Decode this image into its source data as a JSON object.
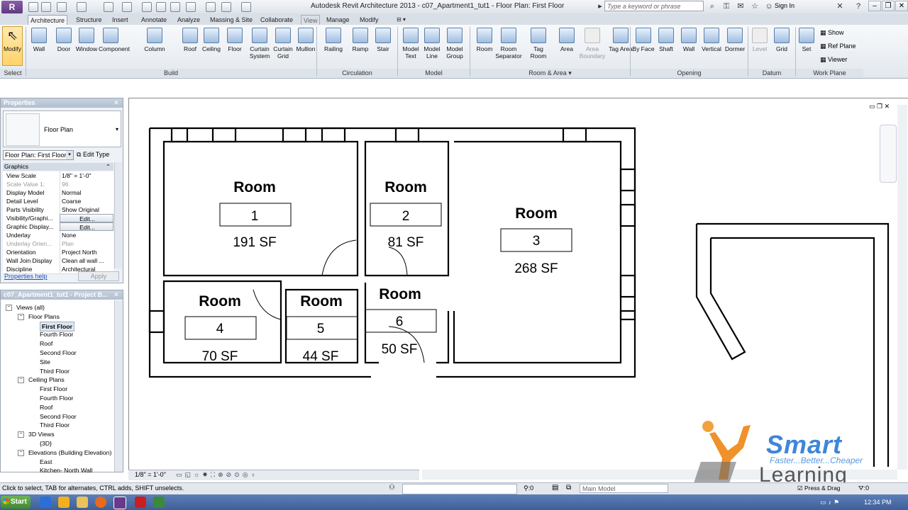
{
  "titlebar": {
    "app_logo": "R",
    "title": "Autodesk Revit Architecture 2013 -     c07_Apartment1_tut1 - Floor Plan: First Floor",
    "search_placeholder": "Type a keyword or phrase",
    "sign_in": "Sign In"
  },
  "tabs": [
    "Architecture",
    "Structure",
    "Insert",
    "Annotate",
    "Analyze",
    "Massing & Site",
    "Collaborate",
    "View",
    "Manage",
    "Modify"
  ],
  "ribbon": {
    "select": [
      {
        "label": "Modify"
      }
    ],
    "build": [
      {
        "label": "Wall"
      },
      {
        "label": "Door"
      },
      {
        "label": "Window"
      },
      {
        "label": "Component"
      },
      {
        "label": "Column"
      },
      {
        "label": "Roof"
      },
      {
        "label": "Ceiling"
      },
      {
        "label": "Floor"
      },
      {
        "label": "Curtain System"
      },
      {
        "label": "Curtain Grid"
      },
      {
        "label": "Mullion"
      }
    ],
    "circulation": [
      {
        "label": "Railing"
      },
      {
        "label": "Ramp"
      },
      {
        "label": "Stair"
      }
    ],
    "model": [
      {
        "label": "Model Text"
      },
      {
        "label": "Model Line"
      },
      {
        "label": "Model Group"
      }
    ],
    "room_area": [
      {
        "label": "Room"
      },
      {
        "label": "Room Separator"
      },
      {
        "label": "Tag Room"
      },
      {
        "label": "Area"
      },
      {
        "label": "Area Boundary"
      },
      {
        "label": "Tag Area"
      }
    ],
    "opening": [
      {
        "label": "By Face"
      },
      {
        "label": "Shaft"
      },
      {
        "label": "Wall"
      },
      {
        "label": "Vertical"
      },
      {
        "label": "Dormer"
      }
    ],
    "datum": [
      {
        "label": "Level"
      },
      {
        "label": "Grid"
      }
    ],
    "work_plane": [
      {
        "label": "Set"
      },
      {
        "label": "Show"
      },
      {
        "label": "Ref Plane"
      },
      {
        "label": "Viewer"
      }
    ],
    "panels": [
      "Select",
      "Build",
      "Circulation",
      "Model",
      "Room & Area",
      "Opening",
      "Datum",
      "Work Plane"
    ]
  },
  "properties": {
    "title": "Properties",
    "type_name": "Floor Plan",
    "view_selector": "Floor Plan: First Floor",
    "edit_type": "Edit Type",
    "group": "Graphics",
    "rows": [
      {
        "k": "View Scale",
        "v": "1/8\" = 1'-0\""
      },
      {
        "k": "Scale Value    1:",
        "v": "96"
      },
      {
        "k": "Display Model",
        "v": "Normal"
      },
      {
        "k": "Detail Level",
        "v": "Coarse"
      },
      {
        "k": "Parts Visibility",
        "v": "Show Original"
      },
      {
        "k": "Visibility/Graphi...",
        "v": "Edit..."
      },
      {
        "k": "Graphic Display...",
        "v": "Edit..."
      },
      {
        "k": "Underlay",
        "v": "None"
      },
      {
        "k": "Underlay Orien...",
        "v": "Plan"
      },
      {
        "k": "Orientation",
        "v": "Project North"
      },
      {
        "k": "Wall Join Display",
        "v": "Clean all wall ..."
      },
      {
        "k": "Discipline",
        "v": "Architectural"
      }
    ],
    "help": "Properties help",
    "apply": "Apply"
  },
  "browser": {
    "title": "c07_Apartment1_tut1 - Project B...",
    "items": [
      {
        "label": "Views (all)",
        "level": 0
      },
      {
        "label": "Floor Plans",
        "level": 1
      },
      {
        "label": "First Floor",
        "level": 2
      },
      {
        "label": "Fourth Floor",
        "level": 2
      },
      {
        "label": "Roof",
        "level": 2
      },
      {
        "label": "Second Floor",
        "level": 2
      },
      {
        "label": "Site",
        "level": 2
      },
      {
        "label": "Third Floor",
        "level": 2
      },
      {
        "label": "Ceiling Plans",
        "level": 1
      },
      {
        "label": "First Floor",
        "level": 2
      },
      {
        "label": "Fourth Floor",
        "level": 2
      },
      {
        "label": "Roof",
        "level": 2
      },
      {
        "label": "Second Floor",
        "level": 2
      },
      {
        "label": "Third Floor",
        "level": 2
      },
      {
        "label": "3D Views",
        "level": 1
      },
      {
        "label": "{3D}",
        "level": 2
      },
      {
        "label": "Elevations (Building Elevation)",
        "level": 1
      },
      {
        "label": "East",
        "level": 2
      },
      {
        "label": "Kitchen- North Wall",
        "level": 2
      }
    ]
  },
  "rooms": [
    {
      "name": "Room",
      "number": "1",
      "area": "191 SF"
    },
    {
      "name": "Room",
      "number": "2",
      "area": "81 SF"
    },
    {
      "name": "Room",
      "number": "3",
      "area": "268 SF"
    },
    {
      "name": "Room",
      "number": "4",
      "area": "70 SF"
    },
    {
      "name": "Room",
      "number": "5",
      "area": "44 SF"
    },
    {
      "name": "Room",
      "number": "6",
      "area": "50 SF"
    }
  ],
  "view_control": {
    "scale": "1/8\" = 1'-0\""
  },
  "status": {
    "hint": "Click to select, TAB for alternates, CTRL adds, SHIFT unselects.",
    "counter_a": ":0",
    "model": "Main Model",
    "press_drag": "Press & Drag",
    "filter": ":0"
  },
  "taskbar": {
    "start": "Start",
    "clock": "12:34 PM"
  },
  "logo": {
    "smart": "Smart",
    "tagline": "Faster...Better...Cheaper",
    "learning": "Learning"
  }
}
